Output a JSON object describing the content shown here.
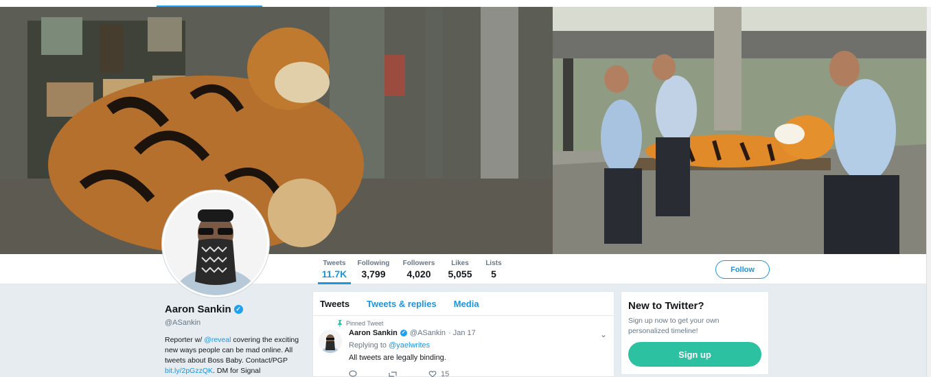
{
  "nav": {
    "stats": [
      {
        "label": "Tweets",
        "value": "11.7K",
        "active": true
      },
      {
        "label": "Following",
        "value": "3,799"
      },
      {
        "label": "Followers",
        "value": "4,020"
      },
      {
        "label": "Likes",
        "value": "5,055"
      },
      {
        "label": "Lists",
        "value": "5"
      }
    ],
    "follow_label": "Follow"
  },
  "profile": {
    "name": "Aaron Sankin",
    "handle": "@ASankin",
    "bio_part1": "Reporter w/ ",
    "bio_mention": "@reveal",
    "bio_part2": " covering the exciting new ways people can be mad online. All tweets about Boss Baby. Contact/PGP ",
    "bio_link": "bit.ly/2pGzzQK",
    "bio_part3": ". DM for Signal"
  },
  "timeline": {
    "tabs": [
      "Tweets",
      "Tweets & replies",
      "Media"
    ],
    "tweet": {
      "pinned_label": "Pinned Tweet",
      "author": "Aaron Sankin",
      "handle": "@ASankin",
      "date": "· Jan 17",
      "reply_prefix": "Replying to ",
      "reply_handle": "@yaelwrites",
      "text": "All tweets are legally binding.",
      "likes": "15"
    }
  },
  "signup": {
    "title": "New to Twitter?",
    "text": "Sign up now to get your own personalized timeline!",
    "button": "Sign up"
  },
  "colors": {
    "accent": "#1b95e0",
    "signup": "#2cc1a0",
    "verified": "#1da1f2"
  }
}
